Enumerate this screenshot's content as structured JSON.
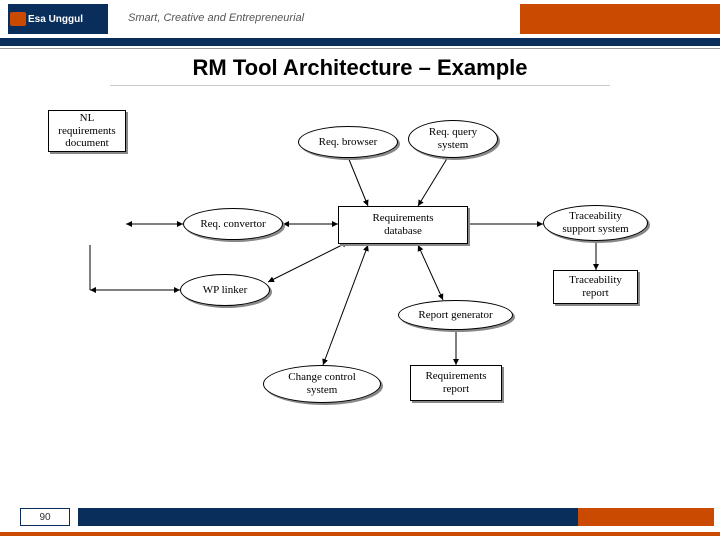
{
  "header": {
    "logo_text": "Esa Unggul",
    "tagline": "Smart, Creative and Entrepreneurial"
  },
  "title": "RM Tool Architecture – Example",
  "page_number": "90",
  "nodes": {
    "nl_req_doc": {
      "l1": "NL",
      "l2": "requirements",
      "l3": "document"
    },
    "req_convertor": {
      "l1": "Req. convertor"
    },
    "wp_linker": {
      "l1": "WP linker"
    },
    "req_browser": {
      "l1": "Req. browser"
    },
    "req_query": {
      "l1": "Req. query",
      "l2": "system"
    },
    "req_db": {
      "l1": "Requirements",
      "l2": "database"
    },
    "change_ctrl": {
      "l1": "Change control",
      "l2": "system"
    },
    "report_gen": {
      "l1": "Report generator"
    },
    "req_report": {
      "l1": "Requirements",
      "l2": "report"
    },
    "trace_sys": {
      "l1": "Traceability",
      "l2": "support system"
    },
    "trace_report": {
      "l1": "Traceability",
      "l2": "report"
    }
  },
  "edges": [
    {
      "from": "nl_req_doc",
      "to": "req_convertor",
      "dir": "both"
    },
    {
      "from": "req_convertor",
      "to": "req_db",
      "dir": "both"
    },
    {
      "from": "nl_req_doc",
      "to": "wp_linker",
      "dir": "both"
    },
    {
      "from": "wp_linker",
      "to": "req_db",
      "dir": "both"
    },
    {
      "from": "req_browser",
      "to": "req_db",
      "dir": "to"
    },
    {
      "from": "req_query",
      "to": "req_db",
      "dir": "to"
    },
    {
      "from": "req_db",
      "to": "trace_sys",
      "dir": "to"
    },
    {
      "from": "trace_sys",
      "to": "trace_report",
      "dir": "to"
    },
    {
      "from": "req_db",
      "to": "change_ctrl",
      "dir": "both"
    },
    {
      "from": "req_db",
      "to": "report_gen",
      "dir": "both"
    },
    {
      "from": "report_gen",
      "to": "req_report",
      "dir": "to"
    }
  ]
}
